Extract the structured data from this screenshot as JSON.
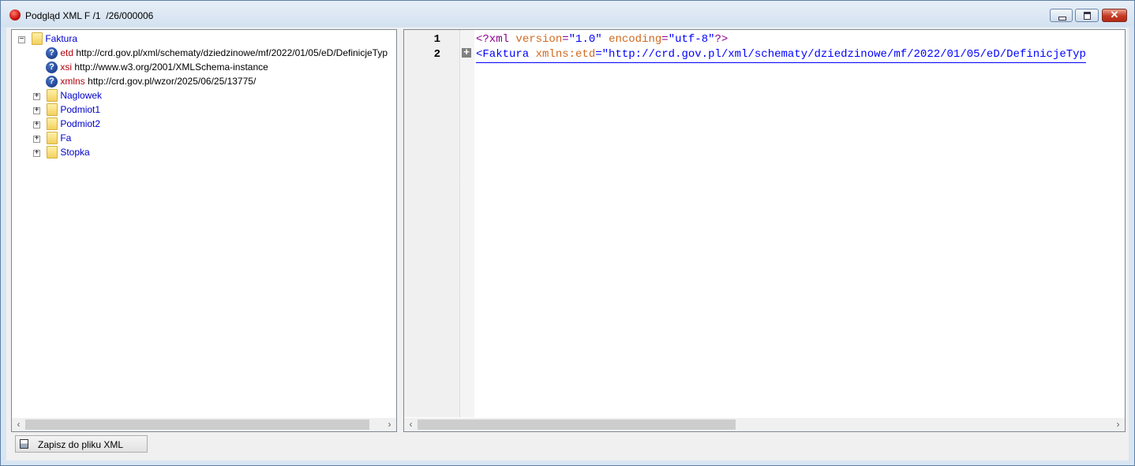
{
  "window": {
    "title": "Podgląd XML F /1  /26/000006",
    "controls": {
      "minimize": "minimize-icon",
      "maximize": "maximize-icon",
      "close": "✕"
    }
  },
  "tree": {
    "root": {
      "label": "Faktura",
      "expander": "−"
    },
    "attributes": [
      {
        "name": "etd",
        "value": "http://crd.gov.pl/xml/schematy/dziedzinowe/mf/2022/01/05/eD/DefinicjeTyp"
      },
      {
        "name": "xsi",
        "value": "http://www.w3.org/2001/XMLSchema-instance"
      },
      {
        "name": "xmlns",
        "value": "http://crd.gov.pl/wzor/2025/06/25/13775/"
      }
    ],
    "children": [
      {
        "label": "Naglowek",
        "expander": "+"
      },
      {
        "label": "Podmiot1",
        "expander": "+"
      },
      {
        "label": "Podmiot2",
        "expander": "+"
      },
      {
        "label": "Fa",
        "expander": "+"
      },
      {
        "label": "Stopka",
        "expander": "+"
      }
    ]
  },
  "xml_view": {
    "line_numbers": [
      "1",
      "2"
    ],
    "line1": {
      "open": "<?xml",
      "attr1": "version",
      "eq1": "=",
      "val1": "\"1.0\"",
      "attr2": "encoding",
      "eq2": "=",
      "val2": "\"utf-8\"",
      "close": "?>"
    },
    "line2": {
      "open": "<Faktura",
      "attr1": "xmlns:etd",
      "eq1": "=",
      "val1": "\"http://crd.gov.pl/xml/schematy/dziedzinowe/mf/2022/01/05/eD/DefinicjeTyp"
    },
    "fold_marker": "+"
  },
  "scroll": {
    "left_arrow": "‹",
    "right_arrow": "›"
  },
  "footer": {
    "save_button_label": "Zapisz do pliku XML"
  },
  "colors": {
    "tree_label": "#0000cc",
    "attr_name": "#b3000c",
    "xml_tag": "#0000ff",
    "xml_attr": "#d2691e",
    "xml_pi": "#8b008b"
  }
}
